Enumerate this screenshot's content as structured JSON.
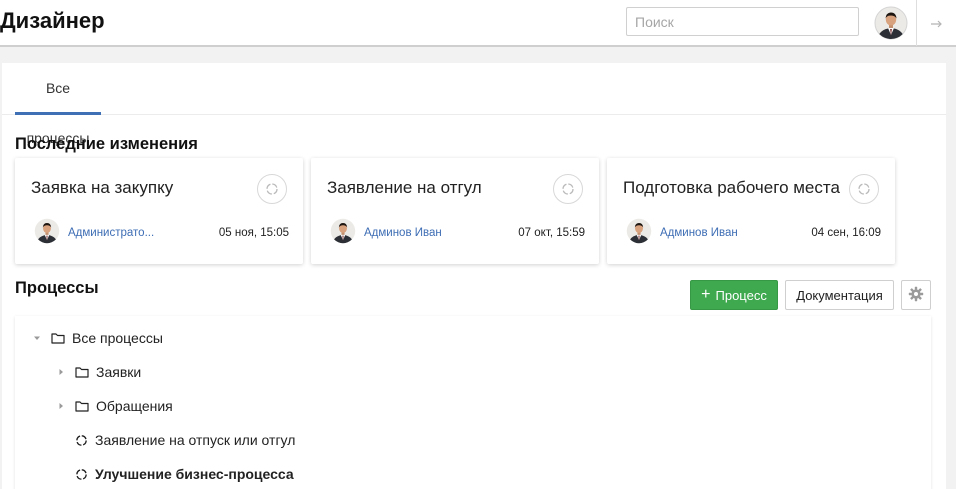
{
  "app": {
    "title": "Дизайнер"
  },
  "search": {
    "placeholder": "Поиск",
    "value": ""
  },
  "tabs": [
    {
      "label": "Все процессы",
      "active": true
    }
  ],
  "recent": {
    "title": "Последние изменения",
    "cards": [
      {
        "title": "Заявка на закупку",
        "author": "Администрато...",
        "date": "05 ноя, 15:05"
      },
      {
        "title": "Заявление на отгул",
        "author": "Админов Иван",
        "date": "07 окт, 15:59"
      },
      {
        "title": "Подготовка рабочего места",
        "author": "Админов Иван",
        "date": "04 сен, 16:09"
      }
    ]
  },
  "processes": {
    "title": "Процессы",
    "add_button": "Процесс",
    "docs_button": "Документация",
    "tree": [
      {
        "label": "Все процессы",
        "type": "folder",
        "level": 0,
        "expanded": true
      },
      {
        "label": "Заявки",
        "type": "folder",
        "level": 1,
        "expanded": false
      },
      {
        "label": "Обращения",
        "type": "folder",
        "level": 1,
        "expanded": false
      },
      {
        "label": "Заявление на отпуск или отгул",
        "type": "process",
        "level": 1
      },
      {
        "label": "Улучшение бизнес-процесса",
        "type": "process",
        "level": 1,
        "bold": true
      }
    ]
  },
  "colors": {
    "accent": "#3f6fb5",
    "link": "#3d6db4",
    "success": "#3ea94f",
    "background": "#f2f2f2"
  },
  "icons": {
    "logout": "arrow-right-icon",
    "process": "process-circle-icon",
    "folder": "folder-icon",
    "settings": "gear-icon",
    "caret_expanded": "caret-down-icon",
    "caret_collapsed": "caret-right-icon"
  }
}
